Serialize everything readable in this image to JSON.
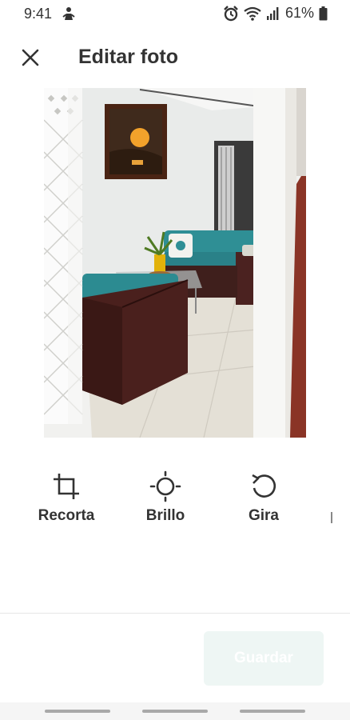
{
  "status_bar": {
    "time": "9:41",
    "battery_percent": "61%",
    "icons": [
      "person-icon",
      "alarm-icon",
      "wifi-icon",
      "signal-icon",
      "battery-icon"
    ]
  },
  "header": {
    "title": "Editar foto",
    "close_icon": "close-icon"
  },
  "photo": {
    "subject": "interior-living-room"
  },
  "tools": [
    {
      "label": "Recorta",
      "icon": "crop-icon"
    },
    {
      "label": "Brillo",
      "icon": "brightness-icon"
    },
    {
      "label": "Gira",
      "icon": "rotate-icon"
    }
  ],
  "footer": {
    "save_label": "Guardar",
    "save_enabled": false
  },
  "colors": {
    "text": "#333333",
    "save_bg": "#eef6f4",
    "divider": "#e6e6e6"
  }
}
